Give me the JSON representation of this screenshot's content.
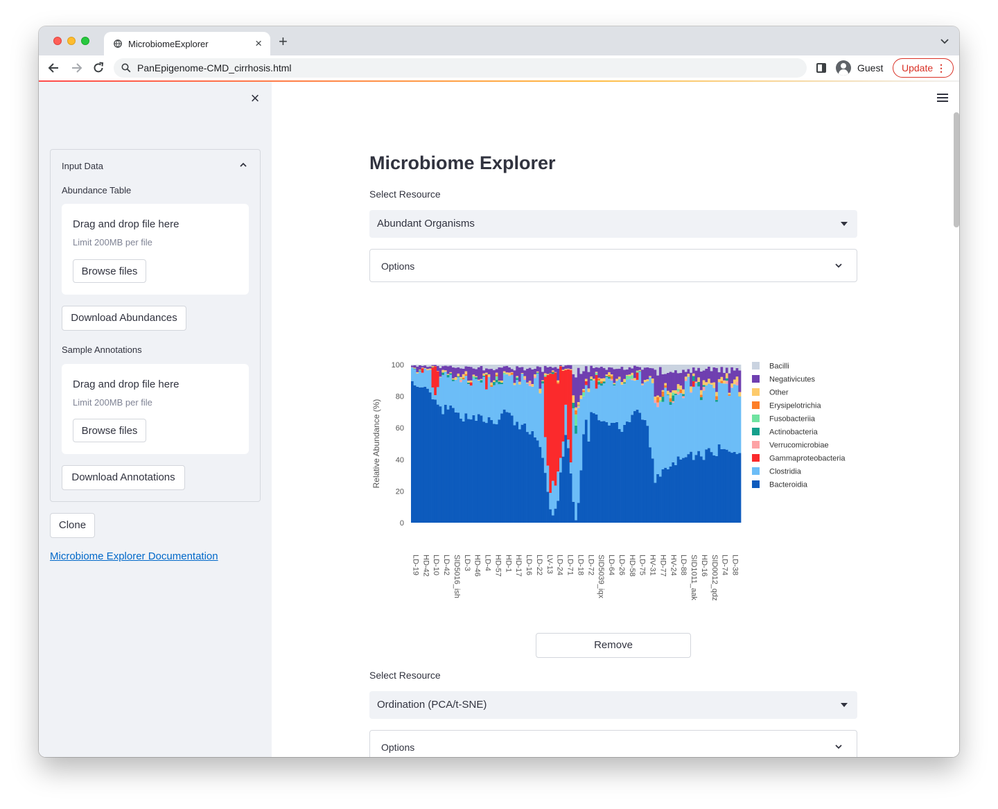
{
  "browser": {
    "tab_title": "MicrobiomeExplorer",
    "new_tab": "+",
    "url": "PanEpigenome-CMD_cirrhosis.html",
    "profile_name": "Guest",
    "update_label": "Update"
  },
  "sidebar": {
    "close_glyph": "×",
    "expander_title": "Input Data",
    "abundance": {
      "label": "Abundance Table",
      "drop_title": "Drag and drop file here",
      "drop_limit": "Limit 200MB per file",
      "browse_label": "Browse files",
      "download_label": "Download Abundances"
    },
    "annotations": {
      "label": "Sample Annotations",
      "drop_title": "Drag and drop file here",
      "drop_limit": "Limit 200MB per file",
      "browse_label": "Browse files",
      "download_label": "Download Annotations"
    },
    "clone_label": "Clone",
    "doc_link": "Microbiome Explorer Documentation"
  },
  "main": {
    "title": "Microbiome Explorer",
    "panel1": {
      "select_label": "Select Resource",
      "select_value": "Abundant Organisms",
      "options_label": "Options",
      "remove_label": "Remove"
    },
    "panel2": {
      "select_label": "Select Resource",
      "select_value": "Ordination (PCA/t-SNE)",
      "options_label": "Options"
    }
  },
  "chart_data": {
    "type": "bar",
    "stacked": true,
    "ylabel": "Relative Abundance (%)",
    "ylim": [
      0,
      100
    ],
    "yticks": [
      0,
      20,
      40,
      60,
      80,
      100
    ],
    "xtick_labels": [
      "LD-19",
      "HD-42",
      "LD-10",
      "LD-42",
      "SID5016_ish",
      "LD-3",
      "HD-46",
      "LD-4",
      "HD-57",
      "HD-1",
      "HD-17",
      "LD-16",
      "LD-22",
      "LV-13",
      "LD-24",
      "LD-71",
      "LD-18",
      "LD-72",
      "SID5039_iqx",
      "LD-64",
      "LD-26",
      "HD-58",
      "LD-75",
      "HV-31",
      "HD-77",
      "HV-24",
      "LD-88",
      "SID1011_aak",
      "HD-16",
      "SID0012_qdz",
      "LD-74",
      "LD-38"
    ],
    "legend_position": "right",
    "legend": [
      "Bacilli",
      "Negativicutes",
      "Other",
      "Erysipelotrichia",
      "Fusobacteriia",
      "Actinobacteria",
      "Verrucomicrobiae",
      "Gammaproteobacteria",
      "Clostridia",
      "Bacteroidia"
    ],
    "colors": {
      "Bacilli": "#cad3e0",
      "Negativicutes": "#6f3fb0",
      "Other": "#fdca6b",
      "Erysipelotrichia": "#fd7f28",
      "Fusobacteriia": "#6fe3a1",
      "Actinobacteria": "#14a08c",
      "Verrucomicrobiae": "#fda3a5",
      "Gammaproteobacteria": "#fb2a2c",
      "Clostridia": "#6cbdf7",
      "Bacteroidia": "#0d5bbd"
    },
    "bacteroidia_profile": [
      [
        0,
        88
      ],
      [
        3,
        87
      ],
      [
        6,
        84
      ],
      [
        8,
        80
      ],
      [
        10,
        72
      ],
      [
        12,
        70
      ],
      [
        14,
        74
      ],
      [
        16,
        71
      ],
      [
        18,
        69
      ],
      [
        20,
        66
      ],
      [
        22,
        68
      ],
      [
        24,
        66
      ],
      [
        26,
        67
      ],
      [
        28,
        66
      ],
      [
        30,
        65
      ],
      [
        32,
        63
      ],
      [
        34,
        66
      ],
      [
        36,
        70
      ],
      [
        38,
        68
      ],
      [
        40,
        62
      ],
      [
        42,
        60
      ],
      [
        44,
        64
      ],
      [
        46,
        56
      ],
      [
        48,
        54
      ],
      [
        50,
        48
      ],
      [
        51,
        42
      ],
      [
        52,
        33
      ],
      [
        53,
        22
      ],
      [
        54,
        10
      ],
      [
        55,
        5
      ],
      [
        56,
        8
      ],
      [
        57,
        15
      ],
      [
        58,
        30
      ],
      [
        59,
        42
      ],
      [
        60,
        55
      ],
      [
        61,
        48
      ],
      [
        62,
        30
      ],
      [
        63,
        15
      ],
      [
        64,
        2
      ],
      [
        65,
        15
      ],
      [
        66,
        35
      ],
      [
        67,
        55
      ],
      [
        68,
        66
      ],
      [
        69,
        52
      ],
      [
        70,
        68
      ],
      [
        72,
        66
      ],
      [
        74,
        62
      ],
      [
        76,
        63
      ],
      [
        78,
        62
      ],
      [
        80,
        63
      ],
      [
        82,
        60
      ],
      [
        84,
        64
      ],
      [
        86,
        67
      ],
      [
        88,
        69
      ],
      [
        90,
        67
      ],
      [
        92,
        62
      ],
      [
        93,
        50
      ],
      [
        94,
        38
      ],
      [
        95,
        24
      ],
      [
        96,
        30
      ],
      [
        97,
        32
      ],
      [
        98,
        36
      ],
      [
        100,
        34
      ],
      [
        102,
        38
      ],
      [
        104,
        40
      ],
      [
        106,
        40
      ],
      [
        108,
        42
      ],
      [
        110,
        42
      ],
      [
        112,
        44
      ],
      [
        114,
        41
      ],
      [
        116,
        46
      ],
      [
        118,
        42
      ],
      [
        120,
        48
      ],
      [
        122,
        46
      ],
      [
        124,
        44
      ],
      [
        126,
        42
      ],
      [
        128,
        42
      ]
    ]
  }
}
